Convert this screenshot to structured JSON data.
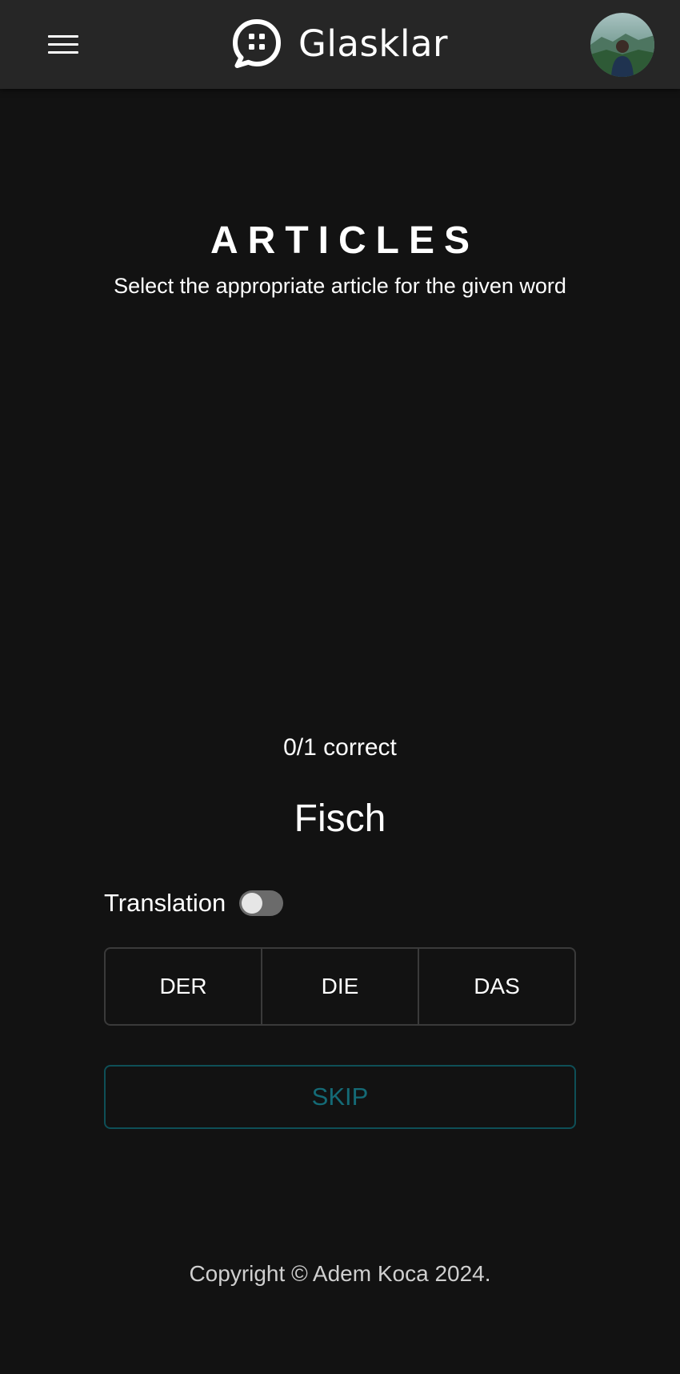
{
  "header": {
    "menu_icon": "hamburger-menu-icon",
    "brand_name": "Glasklar",
    "logo_icon": "chat-bubble-grid-icon",
    "avatar_icon": "user-avatar"
  },
  "main": {
    "title": "ARTICLES",
    "subtitle": "Select the appropriate article for the given word",
    "score_text": "0/1 correct",
    "word": "Fisch",
    "translation_label": "Translation",
    "translation_enabled": false,
    "articles": [
      "DER",
      "DIE",
      "DAS"
    ],
    "skip_label": "SKIP"
  },
  "footer": {
    "copyright": "Copyright © Adem Koca 2024."
  },
  "colors": {
    "background": "#121212",
    "header": "#262626",
    "skip_accent": "#146a76",
    "skip_border": "#0e4f57"
  }
}
